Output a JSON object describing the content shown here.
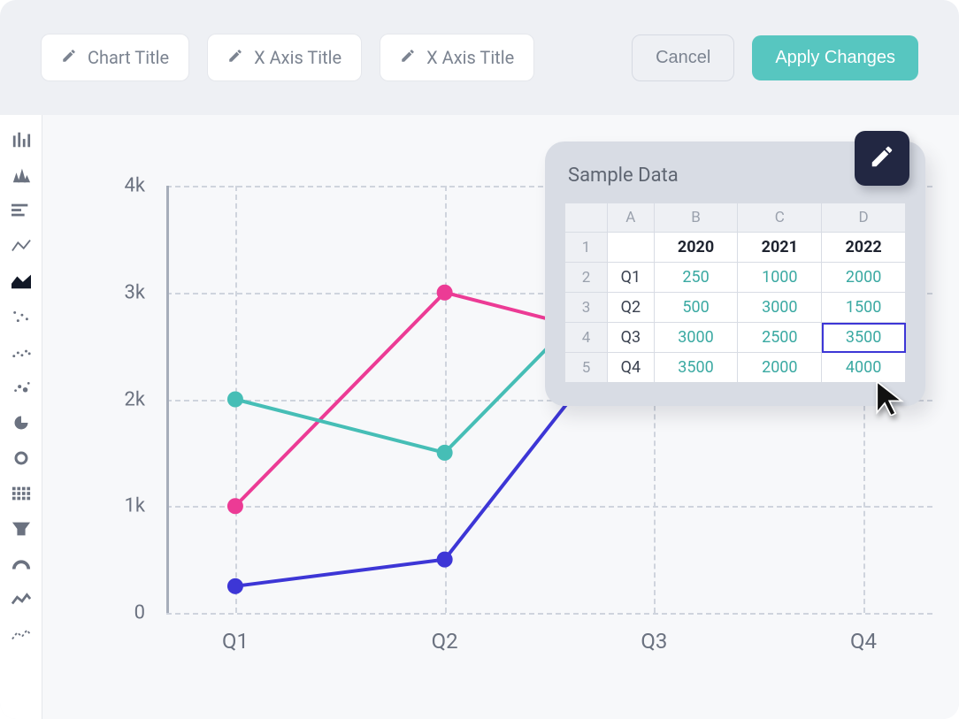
{
  "toolbar": {
    "chart_title_label": "Chart Title",
    "x_axis_title_label_1": "X Axis Title",
    "x_axis_title_label_2": "X Axis Title",
    "cancel_label": "Cancel",
    "apply_label": "Apply Changes"
  },
  "sidebar": {
    "items": [
      {
        "name": "bar-columns-icon"
      },
      {
        "name": "bar-series-icon"
      },
      {
        "name": "bar-horizontal-icon"
      },
      {
        "name": "line-icon"
      },
      {
        "name": "area-icon",
        "active": true
      },
      {
        "name": "scatter-sparse-icon"
      },
      {
        "name": "scatter-dense-icon"
      },
      {
        "name": "bubble-icon"
      },
      {
        "name": "pie-icon"
      },
      {
        "name": "donut-icon"
      },
      {
        "name": "heatmap-icon"
      },
      {
        "name": "funnel-icon"
      },
      {
        "name": "gauge-icon"
      },
      {
        "name": "spark-solid-icon"
      },
      {
        "name": "spark-dashed-icon"
      }
    ]
  },
  "panel": {
    "title": "Sample Data",
    "col_headers": [
      "A",
      "B",
      "C",
      "D"
    ],
    "row_indices": [
      "1",
      "2",
      "3",
      "4",
      "5"
    ],
    "header_row": [
      "",
      "2020",
      "2021",
      "2022"
    ],
    "rows": [
      [
        "Q1",
        "250",
        "1000",
        "2000"
      ],
      [
        "Q2",
        "500",
        "3000",
        "1500"
      ],
      [
        "Q3",
        "3000",
        "2500",
        "3500"
      ],
      [
        "Q4",
        "3500",
        "2000",
        "4000"
      ]
    ],
    "selected_cell": {
      "r": 3,
      "c": 4
    }
  },
  "chart_data": {
    "type": "line",
    "categories": [
      "Q1",
      "Q2",
      "Q3",
      "Q4"
    ],
    "series": [
      {
        "name": "2020",
        "color": "#3d36d6",
        "values": [
          250,
          500,
          3000,
          3500
        ]
      },
      {
        "name": "2021",
        "color": "#ec3b95",
        "values": [
          1000,
          3000,
          2500,
          2000
        ]
      },
      {
        "name": "2022",
        "color": "#46beb6",
        "values": [
          2000,
          1500,
          3500,
          4000
        ]
      }
    ],
    "title": "",
    "xlabel": "",
    "ylabel": "",
    "y_ticks": [
      "0",
      "1k",
      "2k",
      "3k",
      "4k"
    ],
    "ylim": [
      0,
      4000
    ],
    "grid": true
  },
  "colors": {
    "accent": "#57c6c0",
    "panel": "#d8dce4",
    "chip": "#222742",
    "select": "#3d36d6"
  }
}
